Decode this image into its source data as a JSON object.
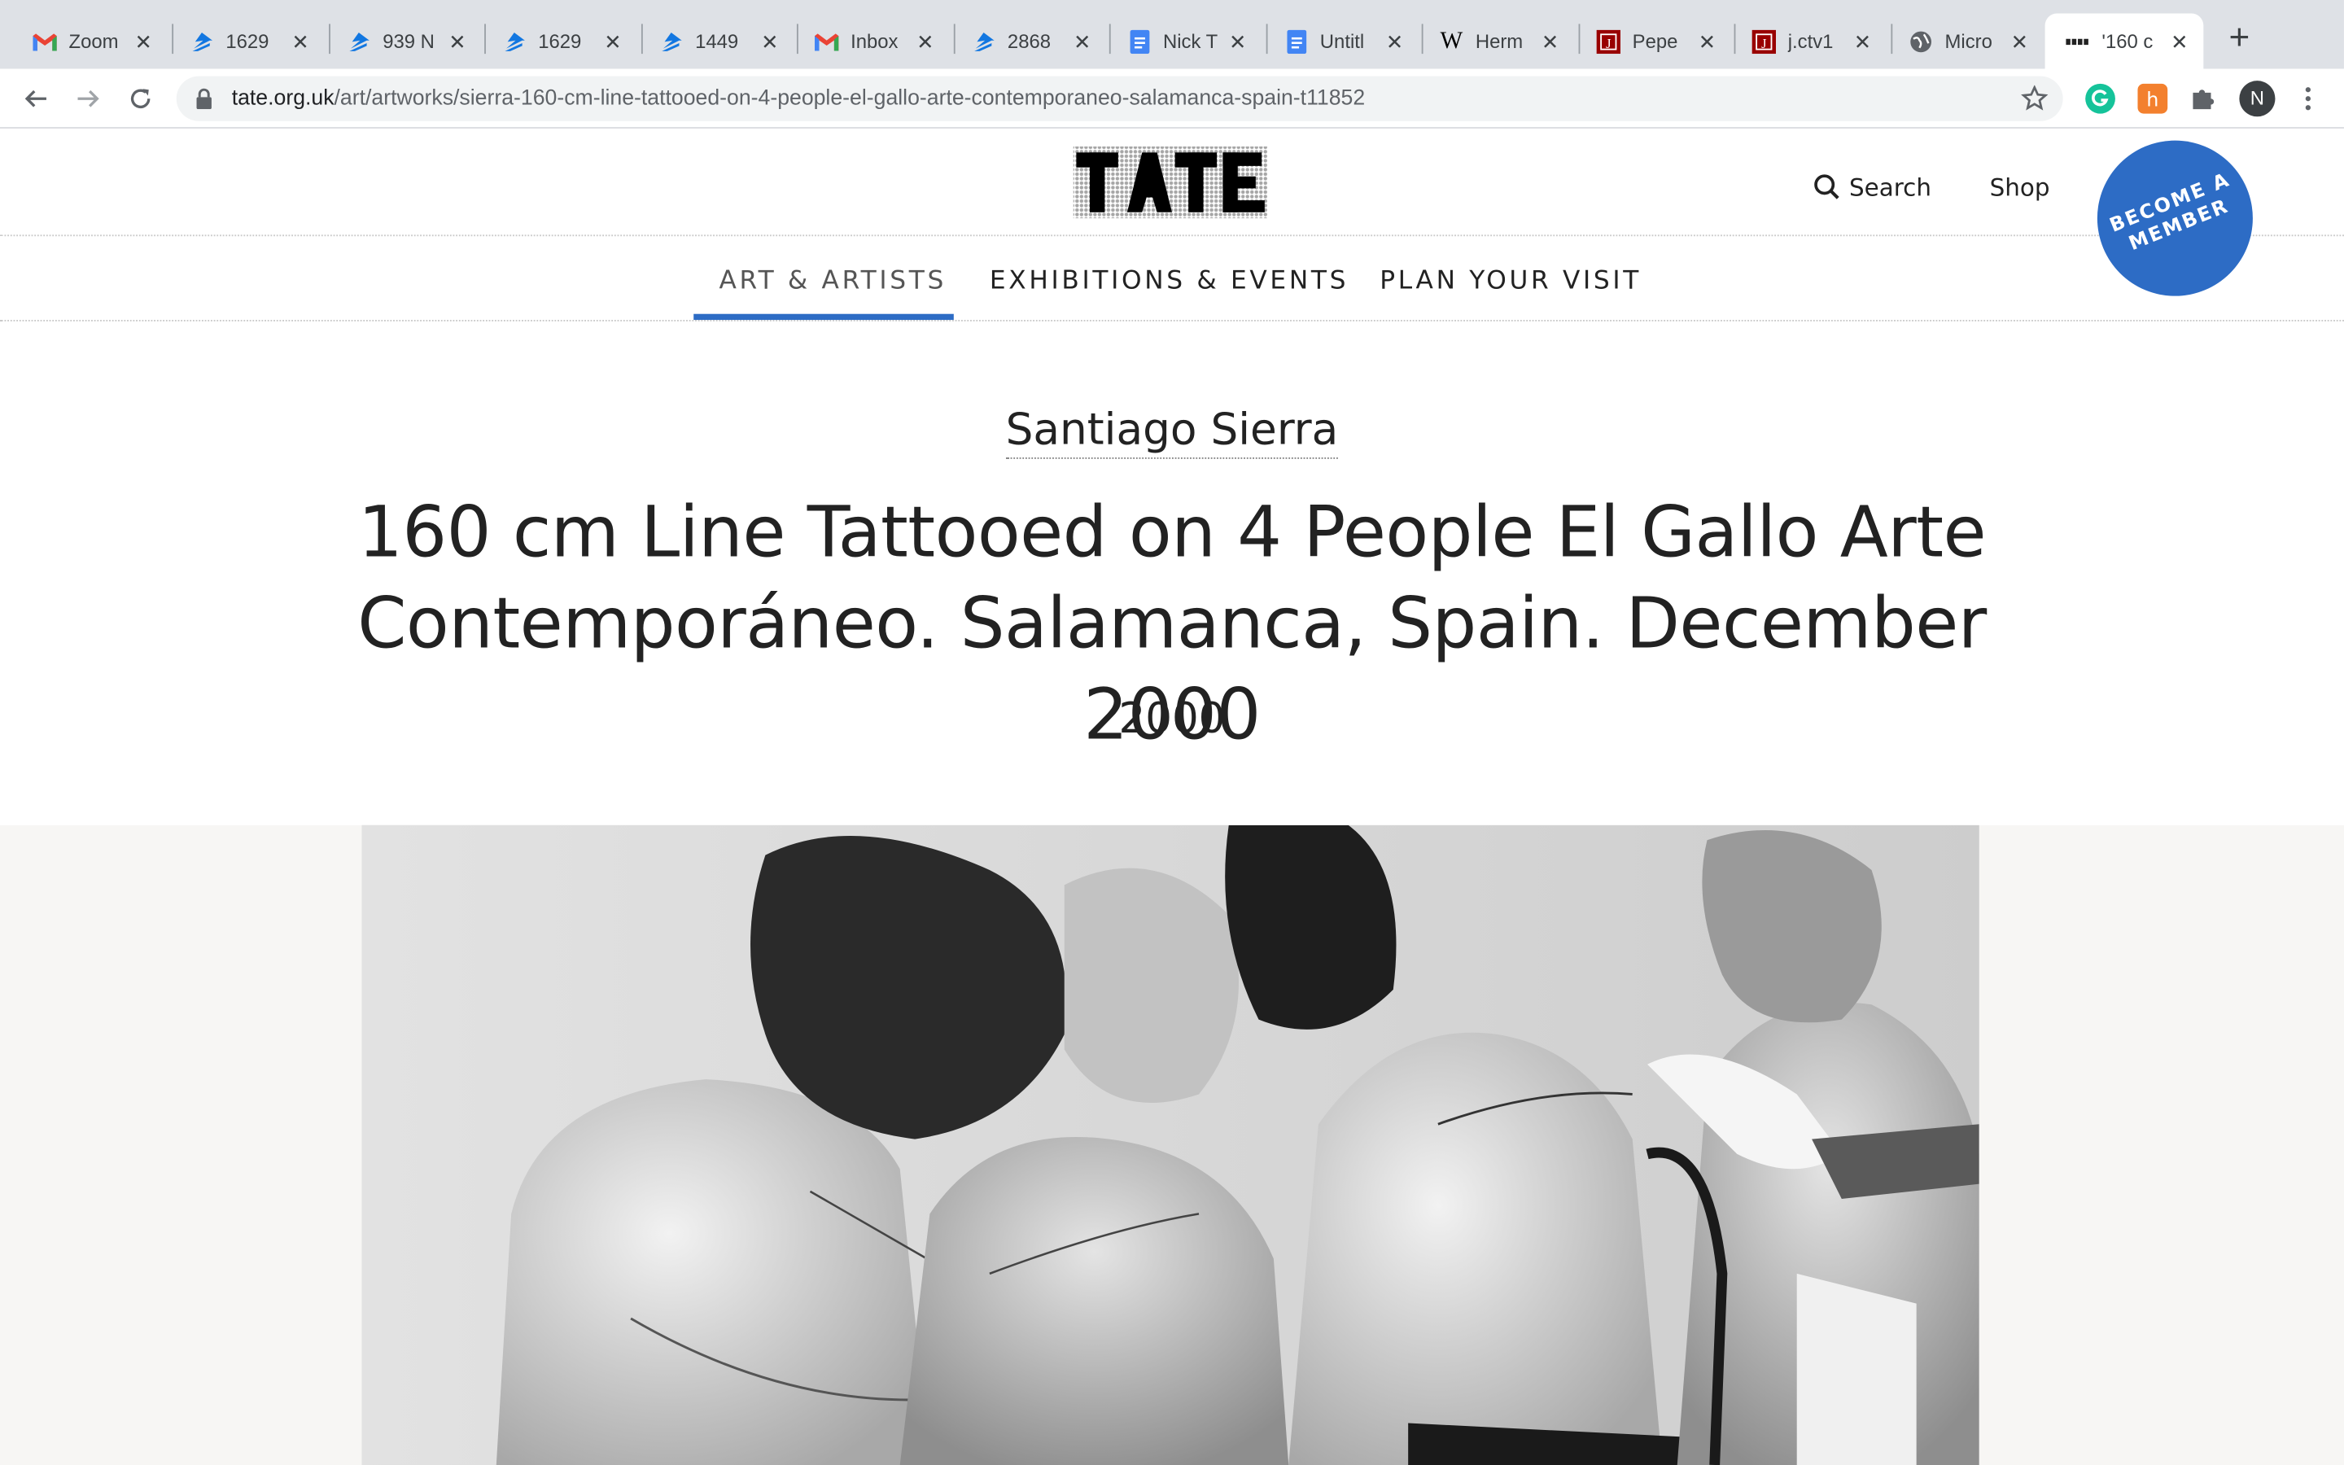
{
  "browser": {
    "tabs": [
      {
        "title": "Zoom",
        "icon": "gmail-icon"
      },
      {
        "title": "1629",
        "icon": "zillow-icon"
      },
      {
        "title": "939 N",
        "icon": "zillow-icon"
      },
      {
        "title": "1629",
        "icon": "zillow-icon"
      },
      {
        "title": "1449",
        "icon": "zillow-icon"
      },
      {
        "title": "Inbox",
        "icon": "gmail-icon"
      },
      {
        "title": "2868",
        "icon": "zillow-icon"
      },
      {
        "title": "Nick T",
        "icon": "google-docs-icon"
      },
      {
        "title": "Untitl",
        "icon": "google-docs-icon"
      },
      {
        "title": "Herm",
        "icon": "wikipedia-icon"
      },
      {
        "title": "Pepe",
        "icon": "jstor-icon"
      },
      {
        "title": "j.ctv1",
        "icon": "jstor-icon"
      },
      {
        "title": "Micro",
        "icon": "globe-icon"
      },
      {
        "title": "'160 c",
        "icon": "tate-favicon"
      }
    ],
    "url_host": "tate.org.uk",
    "url_path": "/art/artworks/sierra-160-cm-line-tattooed-on-4-people-el-gallo-arte-contemporaneo-salamanca-spain-t11852",
    "profile_initial": "N"
  },
  "header": {
    "search_label": "Search",
    "shop_label": "Shop",
    "member_label": "BECOME A MEMBER"
  },
  "nav": {
    "items": [
      "ART & ARTISTS",
      "EXHIBITIONS & EVENTS",
      "PLAN YOUR VISIT"
    ],
    "active_index": 0
  },
  "artwork": {
    "artist": "Santiago Sierra",
    "title": "160 cm Line Tattooed on 4 People El Gallo Arte Contemporáneo. Salamanca, Spain. December 2000",
    "year": "2000"
  },
  "colors": {
    "accent": "#2d6cc5",
    "tabstrip": "#dee1e6",
    "image_band": "#f7f6f4"
  }
}
